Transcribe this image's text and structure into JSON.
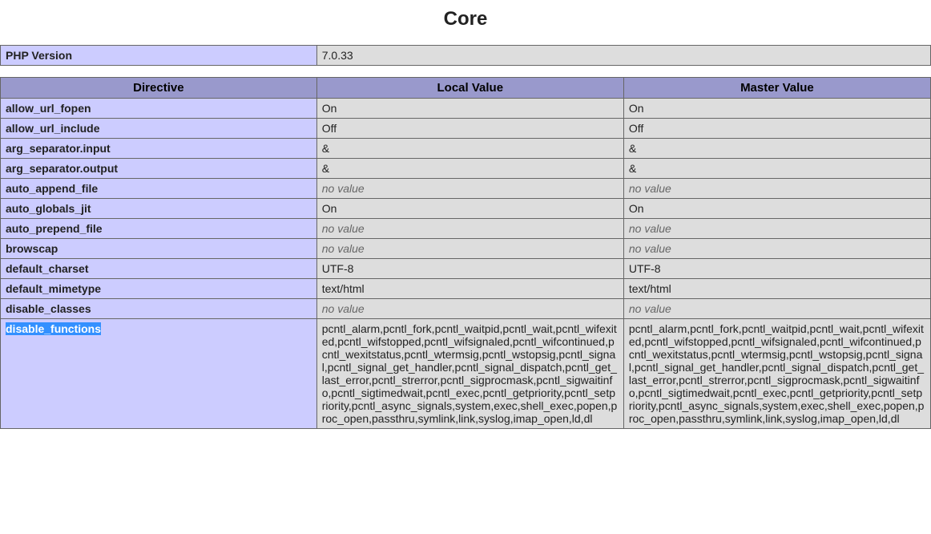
{
  "section_title": "Core",
  "version_row": {
    "label": "PHP Version",
    "value": "7.0.33"
  },
  "table_header": {
    "directive": "Directive",
    "local": "Local Value",
    "master": "Master Value"
  },
  "no_value_text": "no value",
  "rows": [
    {
      "name": "allow_url_fopen",
      "local": "On",
      "master": "On"
    },
    {
      "name": "allow_url_include",
      "local": "Off",
      "master": "Off"
    },
    {
      "name": "arg_separator.input",
      "local": "&",
      "master": "&"
    },
    {
      "name": "arg_separator.output",
      "local": "&",
      "master": "&"
    },
    {
      "name": "auto_append_file",
      "local": null,
      "master": null
    },
    {
      "name": "auto_globals_jit",
      "local": "On",
      "master": "On"
    },
    {
      "name": "auto_prepend_file",
      "local": null,
      "master": null
    },
    {
      "name": "browscap",
      "local": null,
      "master": null
    },
    {
      "name": "default_charset",
      "local": "UTF-8",
      "master": "UTF-8"
    },
    {
      "name": "default_mimetype",
      "local": "text/html",
      "master": "text/html"
    },
    {
      "name": "disable_classes",
      "local": null,
      "master": null
    },
    {
      "name": "disable_functions",
      "selected": true,
      "local": "pcntl_alarm,pcntl_fork,pcntl_waitpid,pcntl_wait,pcntl_wifexited,pcntl_wifstopped,pcntl_wifsignaled,pcntl_wifcontinued,pcntl_wexitstatus,pcntl_wtermsig,pcntl_wstopsig,pcntl_signal,pcntl_signal_get_handler,pcntl_signal_dispatch,pcntl_get_last_error,pcntl_strerror,pcntl_sigprocmask,pcntl_sigwaitinfo,pcntl_sigtimedwait,pcntl_exec,pcntl_getpriority,pcntl_setpriority,pcntl_async_signals,system,exec,shell_exec,popen,proc_open,passthru,symlink,link,syslog,imap_open,ld,dl",
      "master": "pcntl_alarm,pcntl_fork,pcntl_waitpid,pcntl_wait,pcntl_wifexited,pcntl_wifstopped,pcntl_wifsignaled,pcntl_wifcontinued,pcntl_wexitstatus,pcntl_wtermsig,pcntl_wstopsig,pcntl_signal,pcntl_signal_get_handler,pcntl_signal_dispatch,pcntl_get_last_error,pcntl_strerror,pcntl_sigprocmask,pcntl_sigwaitinfo,pcntl_sigtimedwait,pcntl_exec,pcntl_getpriority,pcntl_setpriority,pcntl_async_signals,system,exec,shell_exec,popen,proc_open,passthru,symlink,link,syslog,imap_open,ld,dl"
    }
  ]
}
